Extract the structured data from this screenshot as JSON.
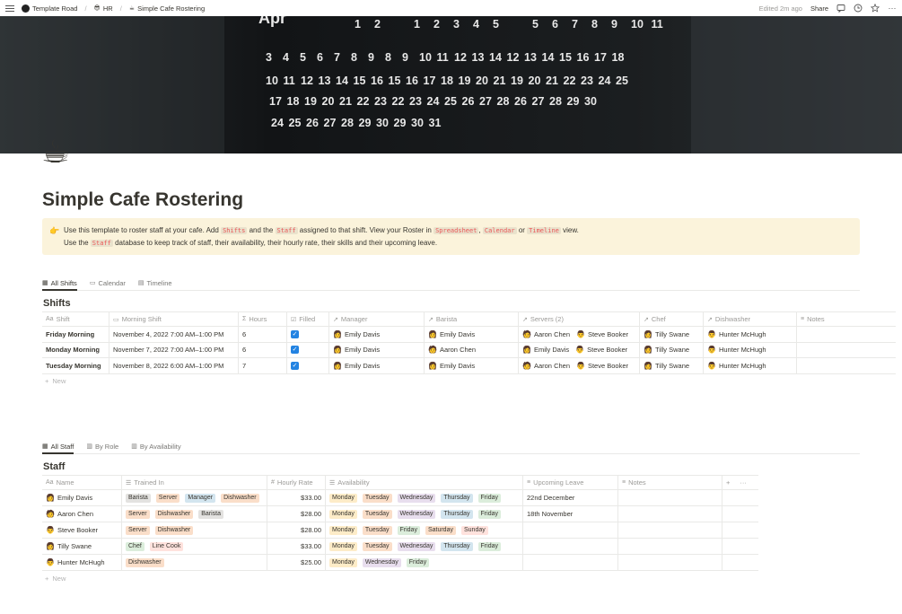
{
  "breadcrumb": {
    "workspace": "Template Road",
    "section_icon": "😎",
    "section": "HR",
    "page_icon": "☕",
    "page": "Simple Cafe Rostering"
  },
  "topbar": {
    "edited": "Edited 2m ago",
    "share": "Share"
  },
  "cover": {
    "month_label": "Apr",
    "calendar_rows": [
      [
        "1",
        "2",
        "",
        "1",
        "2",
        "3",
        "4",
        "5",
        "",
        "5",
        "6",
        "7",
        "8",
        "9",
        "10",
        "11"
      ],
      [
        "3",
        "4",
        "5",
        "6",
        "7",
        "8",
        "9",
        "8",
        "9",
        "10",
        "11",
        "12",
        "13",
        "14",
        "12",
        "13",
        "14",
        "15",
        "16",
        "17",
        "18"
      ],
      [
        "10",
        "11",
        "12",
        "13",
        "14",
        "15",
        "16",
        "15",
        "16",
        "17",
        "18",
        "19",
        "20",
        "21",
        "19",
        "20",
        "21",
        "22",
        "23",
        "24",
        "25"
      ],
      [
        "17",
        "18",
        "19",
        "20",
        "21",
        "22",
        "23",
        "22",
        "23",
        "24",
        "25",
        "26",
        "27",
        "28",
        "26",
        "27",
        "28",
        "29",
        "30"
      ],
      [
        "24",
        "25",
        "26",
        "27",
        "28",
        "29",
        "30",
        "29",
        "30",
        "31"
      ]
    ]
  },
  "page": {
    "icon": "☕",
    "title": "Simple Cafe Rostering"
  },
  "callout": {
    "icon": "👉",
    "line1_a": "Use this template to roster staff at your cafe. Add ",
    "code_shifts": "Shifts",
    "line1_b": " and the ",
    "code_staff": "Staff",
    "line1_c": " assigned to that shift. View your Roster in ",
    "code_spreadsheet": "Spreadsheet",
    "sep1": ", ",
    "code_calendar": "Calendar",
    "or": " or ",
    "code_timeline": "Timeline",
    "line1_d": " view.",
    "line2_a": "Use the ",
    "code_staff2": "Staff",
    "line2_b": " database to keep track of staff, their availability, their hourly rate, their skills and their upcoming leave."
  },
  "shifts_tabs": [
    "All Shifts",
    "Calendar",
    "Timeline"
  ],
  "shifts": {
    "title": "Shifts",
    "headers": [
      "Shift",
      "Morning Shift",
      "Hours",
      "Filled",
      "Manager",
      "Barista",
      "Servers (2)",
      "Chef",
      "Dishwasher",
      "Notes"
    ],
    "rows": [
      {
        "shift": "Friday Morning",
        "time": "November 4, 2022 7:00 AM–1:00 PM",
        "hours": "6",
        "filled": true,
        "manager": "Emily Davis",
        "barista": "Emily Davis",
        "servers": [
          "Aaron Chen",
          "Steve Booker"
        ],
        "chef": "Tilly Swane",
        "dishwasher": "Hunter McHugh"
      },
      {
        "shift": "Monday Morning",
        "time": "November 7, 2022 7:00 AM–1:00 PM",
        "hours": "6",
        "filled": true,
        "manager": "Emily Davis",
        "barista": "Aaron Chen",
        "servers": [
          "Emily Davis",
          "Steve Booker"
        ],
        "chef": "Tilly Swane",
        "dishwasher": "Hunter McHugh"
      },
      {
        "shift": "Tuesday Morning",
        "time": "November 8, 2022 6:00 AM–1:00 PM",
        "hours": "7",
        "filled": true,
        "manager": "Emily Davis",
        "barista": "Emily Davis",
        "servers": [
          "Aaron Chen",
          "Steve Booker"
        ],
        "chef": "Tilly Swane",
        "dishwasher": "Hunter McHugh"
      }
    ],
    "new_label": "New"
  },
  "staff_tabs": [
    "All Staff",
    "By Role",
    "By Availability"
  ],
  "staff": {
    "title": "Staff",
    "headers": [
      "Name",
      "Trained In",
      "Hourly Rate",
      "Availability",
      "Upcoming Leave",
      "Notes"
    ],
    "rows": [
      {
        "name": "Emily Davis",
        "trained": [
          "Barista",
          "Server",
          "Manager",
          "Dishwasher"
        ],
        "rate": "$33.00",
        "availability": [
          "Monday",
          "Tuesday",
          "Wednesday",
          "Thursday",
          "Friday"
        ],
        "leave": "22nd December"
      },
      {
        "name": "Aaron Chen",
        "trained": [
          "Server",
          "Dishwasher",
          "Barista"
        ],
        "rate": "$28.00",
        "availability": [
          "Monday",
          "Tuesday",
          "Wednesday",
          "Thursday",
          "Friday"
        ],
        "leave": "18th November"
      },
      {
        "name": "Steve Booker",
        "trained": [
          "Server",
          "Dishwasher"
        ],
        "rate": "$28.00",
        "availability": [
          "Monday",
          "Tuesday",
          "Friday",
          "Saturday",
          "Sunday"
        ],
        "leave": ""
      },
      {
        "name": "Tilly Swane",
        "trained": [
          "Chef",
          "Line Cook"
        ],
        "rate": "$33.00",
        "availability": [
          "Monday",
          "Tuesday",
          "Wednesday",
          "Thursday",
          "Friday"
        ],
        "leave": ""
      },
      {
        "name": "Hunter McHugh",
        "trained": [
          "Dishwasher"
        ],
        "rate": "$25.00",
        "availability": [
          "Monday",
          "Wednesday",
          "Friday"
        ],
        "leave": ""
      }
    ],
    "new_label": "New"
  },
  "avatars": {
    "Emily Davis": "👩",
    "Aaron Chen": "🧑",
    "Steve Booker": "👨",
    "Tilly Swane": "👩",
    "Hunter McHugh": "👨"
  },
  "tag_colors": {
    "Barista": "#e3e2e0",
    "Server": "#fadec9",
    "Manager": "#d3e5ef",
    "Dishwasher": "#fadec9",
    "Chef": "#dbeddb",
    "Line Cook": "#ffe2dd",
    "Monday": "#fdecc8",
    "Tuesday": "#fadec9",
    "Wednesday": "#e8deee",
    "Thursday": "#d3e5ef",
    "Friday": "#dbeddb",
    "Saturday": "#fadec9",
    "Sunday": "#ffe2dd"
  },
  "checkbox_color": "#2383e2",
  "callout_color": "#fbf3db"
}
